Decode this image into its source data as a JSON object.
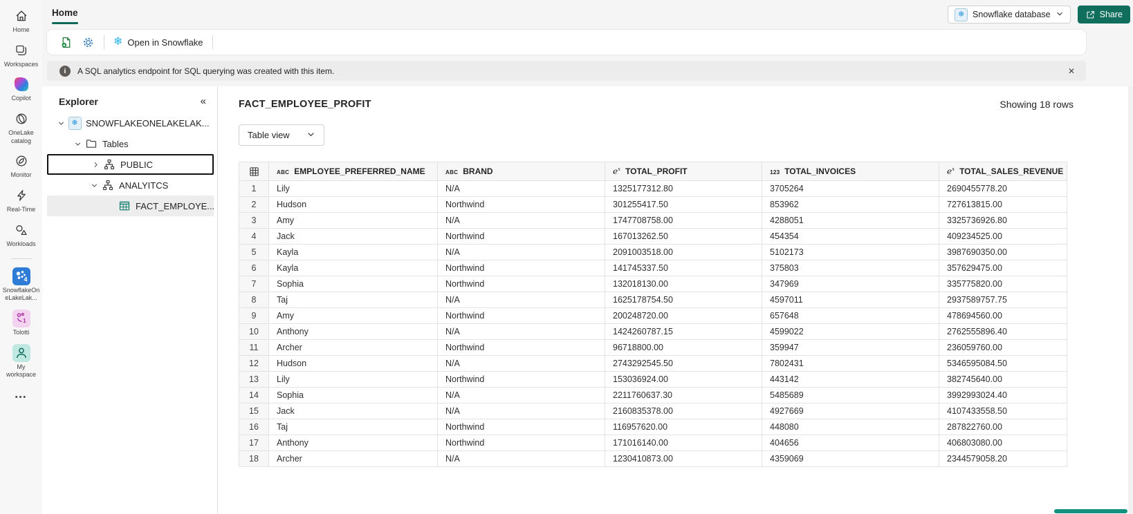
{
  "top_bar": {
    "tab": "Home",
    "database_selector": {
      "label": "Snowflake database",
      "icon": "snowflake-chip-icon"
    },
    "share_button": "Share"
  },
  "toolbar": {
    "open_in_snowflake": "Open in Snowflake"
  },
  "banner": {
    "text": "A SQL analytics endpoint for SQL querying was created with this item.",
    "close": "✕"
  },
  "rail": {
    "items": [
      {
        "label": "Home",
        "icon": "home-icon"
      },
      {
        "label": "Workspaces",
        "icon": "workspaces-icon"
      },
      {
        "label": "Copilot",
        "icon": "copilot-icon"
      },
      {
        "label": "OneLake catalog",
        "icon": "onelake-catalog-icon"
      },
      {
        "label": "Monitor",
        "icon": "monitor-icon"
      },
      {
        "label": "Real-Time",
        "icon": "realtime-icon"
      },
      {
        "label": "Workloads",
        "icon": "workloads-icon"
      },
      {
        "divider": true
      },
      {
        "label": "SnowflakeOneLakeLak...",
        "icon": "snowflake-app-icon",
        "badge": "4"
      },
      {
        "label": "Tolotti",
        "icon": "tolotti-app-icon",
        "badge": "1"
      },
      {
        "label": "My workspace",
        "icon": "my-workspace-icon"
      }
    ],
    "more_label": "•••"
  },
  "explorer": {
    "title": "Explorer",
    "collapse_glyph": "«",
    "tree": [
      {
        "label": "SNOWFLAKEONELAKELAK...",
        "level": 0,
        "chevron": "down",
        "icon": "snowflake-db-icon"
      },
      {
        "label": "Tables",
        "level": 1,
        "chevron": "down",
        "icon": "folder-icon"
      },
      {
        "label": "PUBLIC",
        "level": 2,
        "chevron": "right",
        "icon": "schema-icon",
        "focused": true
      },
      {
        "label": "ANALYITCS",
        "level": 2,
        "chevron": "down",
        "icon": "schema-icon"
      },
      {
        "label": "FACT_EMPLOYE...",
        "level": 3,
        "chevron": "none",
        "icon": "table-icon",
        "selected": true
      }
    ]
  },
  "content": {
    "title": "FACT_EMPLOYEE_PROFIT",
    "rows_summary": "Showing 18 rows",
    "view_selector": "Table view",
    "table": {
      "columns": [
        {
          "name": "EMPLOYEE_PREFERRED_NAME",
          "type_icon": "abc"
        },
        {
          "name": "BRAND",
          "type_icon": "abc"
        },
        {
          "name": "TOTAL_PROFIT",
          "type_icon": "fx"
        },
        {
          "name": "TOTAL_INVOICES",
          "type_icon": "123"
        },
        {
          "name": "TOTAL_SALES_REVENUE",
          "type_icon": "fx"
        }
      ],
      "rows": [
        [
          "1",
          "Lily",
          "N/A",
          "1325177312.80",
          "3705264",
          "2690455778.20"
        ],
        [
          "2",
          "Hudson",
          "Northwind",
          "301255417.50",
          "853962",
          "727613815.00"
        ],
        [
          "3",
          "Amy",
          "N/A",
          "1747708758.00",
          "4288051",
          "3325736926.80"
        ],
        [
          "4",
          "Jack",
          "Northwind",
          "167013262.50",
          "454354",
          "409234525.00"
        ],
        [
          "5",
          "Kayla",
          "N/A",
          "2091003518.00",
          "5102173",
          "3987690350.00"
        ],
        [
          "6",
          "Kayla",
          "Northwind",
          "141745337.50",
          "375803",
          "357629475.00"
        ],
        [
          "7",
          "Sophia",
          "Northwind",
          "132018130.00",
          "347969",
          "335775820.00"
        ],
        [
          "8",
          "Taj",
          "N/A",
          "1625178754.50",
          "4597011",
          "2937589757.75"
        ],
        [
          "9",
          "Amy",
          "Northwind",
          "200248720.00",
          "657648",
          "478694560.00"
        ],
        [
          "10",
          "Anthony",
          "N/A",
          "1424260787.15",
          "4599022",
          "2762555896.40"
        ],
        [
          "11",
          "Archer",
          "Northwind",
          "96718800.00",
          "359947",
          "236059760.00"
        ],
        [
          "12",
          "Hudson",
          "N/A",
          "2743292545.50",
          "7802431",
          "5346595084.50"
        ],
        [
          "13",
          "Lily",
          "Northwind",
          "153036924.00",
          "443142",
          "382745640.00"
        ],
        [
          "14",
          "Sophia",
          "N/A",
          "2211760637.30",
          "5485689",
          "3992993024.40"
        ],
        [
          "15",
          "Jack",
          "N/A",
          "2160835378.00",
          "4927669",
          "4107433558.50"
        ],
        [
          "16",
          "Taj",
          "Northwind",
          "116957620.00",
          "448080",
          "287822760.00"
        ],
        [
          "17",
          "Anthony",
          "Northwind",
          "171016140.00",
          "404656",
          "406803080.00"
        ],
        [
          "18",
          "Archer",
          "N/A",
          "1230410873.00",
          "4359069",
          "2344579058.20"
        ]
      ]
    }
  },
  "colors": {
    "accent_teal": "#0c695a",
    "share_button_bg": "#0f6e5c",
    "snowflake_blue": "#29b5e8",
    "scrollbar_thumb_teal": "#12917e"
  }
}
